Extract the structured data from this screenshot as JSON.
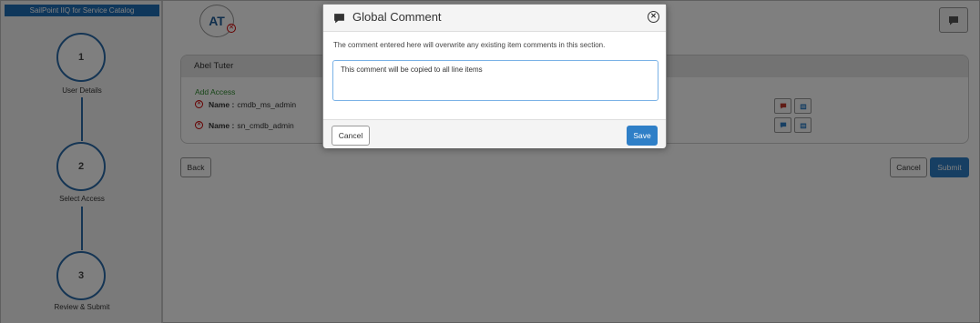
{
  "sidebar": {
    "title": "SailPoint IIQ for Service Catalog",
    "steps": [
      {
        "number": "1",
        "label": "User Details"
      },
      {
        "number": "2",
        "label": "Select Access"
      },
      {
        "number": "3",
        "label": "Review & Submit"
      }
    ]
  },
  "user": {
    "initials": "AT",
    "name": "Abel Tuter"
  },
  "access": {
    "heading": "Add Access",
    "items": [
      {
        "prefix": "Name :",
        "value": "cmdb_ms_admin"
      },
      {
        "prefix": "Name :",
        "value": "sn_cmdb_admin"
      }
    ]
  },
  "buttons": {
    "back": "Back",
    "cancel": "Cancel",
    "submit": "Submit"
  },
  "modal": {
    "title": "Global Comment",
    "description": "The comment entered here will overwrite any existing item comments in this section.",
    "comment_value": "This comment will be copied to all line items",
    "cancel": "Cancel",
    "save": "Save"
  },
  "colors": {
    "primary": "#2f7fc7",
    "success": "#2e8b2e",
    "danger": "#cc0000"
  },
  "icons": {
    "comment": "comment-icon",
    "calendar": "calendar-icon",
    "close": "close-icon",
    "remove": "remove-icon"
  }
}
